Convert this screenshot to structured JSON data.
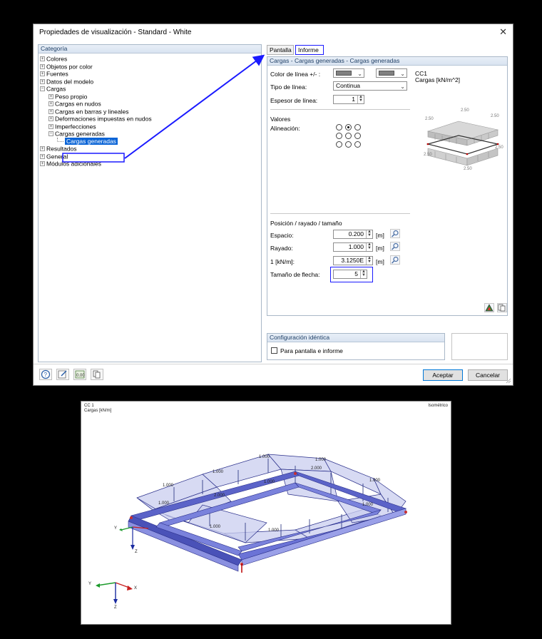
{
  "dialog": {
    "title": "Propiedades de visualización - Standard - White",
    "close_glyph": "✕"
  },
  "categories": {
    "header": "Categoría",
    "items": [
      {
        "label": "Colores",
        "exp": "+",
        "level": 0
      },
      {
        "label": "Objetos por color",
        "exp": "+",
        "level": 0
      },
      {
        "label": "Fuentes",
        "exp": "+",
        "level": 0
      },
      {
        "label": "Datos del modelo",
        "exp": "+",
        "level": 0
      },
      {
        "label": "Cargas",
        "exp": "−",
        "level": 0
      },
      {
        "label": "Peso propio",
        "exp": "+",
        "level": 1
      },
      {
        "label": "Cargas en nudos",
        "exp": "+",
        "level": 1
      },
      {
        "label": "Cargas en barras y lineales",
        "exp": "+",
        "level": 1
      },
      {
        "label": "Deformaciones impuestas en nudos",
        "exp": "+",
        "level": 1
      },
      {
        "label": "Imperfecciones",
        "exp": "+",
        "level": 1
      },
      {
        "label": "Cargas generadas",
        "exp": "−",
        "level": 1
      },
      {
        "label": "Cargas generadas",
        "exp": "",
        "level": 2,
        "selected": true
      },
      {
        "label": "Resultados",
        "exp": "+",
        "level": 0
      },
      {
        "label": "General",
        "exp": "+",
        "level": 0
      },
      {
        "label": "Módulos adicionales",
        "exp": "+",
        "level": 0
      }
    ]
  },
  "tabs": [
    {
      "label": "Pantalla"
    },
    {
      "label": "Informe"
    }
  ],
  "right": {
    "header": "Cargas - Cargas generadas - Cargas generadas",
    "line_color_label": "Color de línea +/- :",
    "line_type_label": "Tipo de línea:",
    "line_type_value": "Continua",
    "line_thickness_label": "Espesor de línea:",
    "line_thickness_value": "1",
    "values_label": "Valores",
    "alignment_label": "Alineación:",
    "position_header": "Posición / rayado / tamaño",
    "spacing_label": "Espacio:",
    "spacing_value": "0.200",
    "hatch_label": "Rayado:",
    "hatch_value": "1.000",
    "scale_label": "1 [kN/m]:",
    "scale_value": "3.1250E",
    "unit_m": "[m]",
    "arrow_size_label": "Tamaño de flecha:",
    "arrow_size_value": "5",
    "colors": {
      "swatch": "#808080"
    }
  },
  "preview": {
    "lc": "CC1",
    "loads": "Cargas [kN/m^2]",
    "values": [
      "2.50",
      "2.50",
      "2.50",
      "2.50",
      "2.50",
      "2.50"
    ]
  },
  "config": {
    "header": "Configuración idéntica",
    "checkbox_label": "Para pantalla e informe"
  },
  "buttons": {
    "ok": "Aceptar",
    "cancel": "Cancelar"
  },
  "report": {
    "lc": "CC 1",
    "loads": "Cargas [kN/m]",
    "view": "Isométrico",
    "labels": [
      "1.000",
      "1.000",
      "1.000",
      "1.000",
      "1.000",
      "2.000",
      "2.000",
      "1.000",
      "1.000",
      "1.000",
      "1.000",
      "1.000"
    ],
    "axis_y": "Y",
    "axis_x": "X",
    "axis_z": "Z"
  },
  "accent": "#1a1aff"
}
